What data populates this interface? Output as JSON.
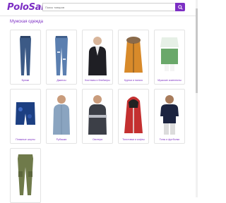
{
  "header": {
    "logo": "PoloSale",
    "search_placeholder": "Поиск товаров",
    "search_icon": "search-icon"
  },
  "section": {
    "title": "Мужская одежда"
  },
  "categories": [
    {
      "label": "Брюки"
    },
    {
      "label": "Джинсы"
    },
    {
      "label": "Костюмы и блейзеры"
    },
    {
      "label": "Куртки и пальто"
    },
    {
      "label": "Мужские комплекты"
    },
    {
      "label": "Пляжные шорты"
    },
    {
      "label": "Рубашки"
    },
    {
      "label": "Свитера"
    },
    {
      "label": "Толстовки и кофты"
    },
    {
      "label": "Топы и футболки"
    },
    {
      "label": ""
    }
  ],
  "colors": {
    "accent": "#7d2fc4"
  }
}
